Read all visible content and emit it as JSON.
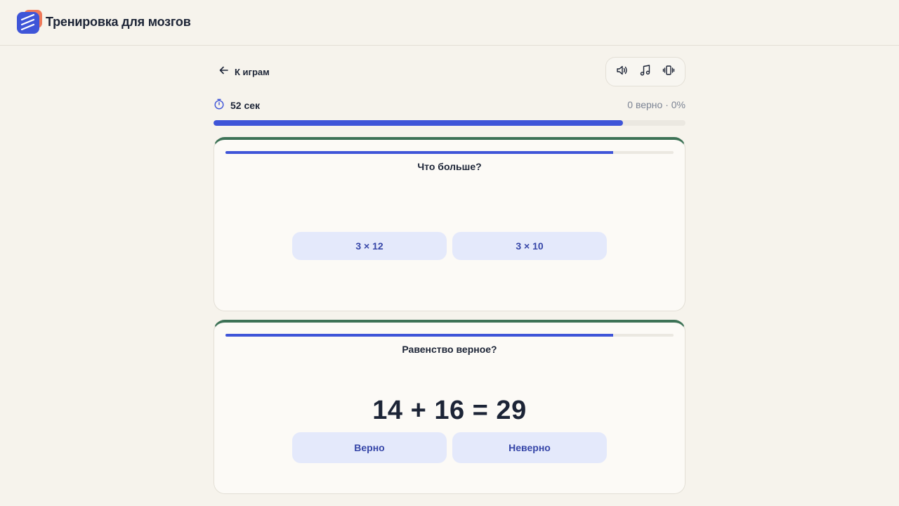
{
  "app": {
    "title": "Тренировка для мозгов"
  },
  "nav": {
    "back_label": "К играм"
  },
  "toolbar": {
    "icons": [
      "speaker-icon",
      "music-note-icon",
      "vibration-icon"
    ]
  },
  "status": {
    "timer": "52 сек",
    "score": "0 верно · 0%",
    "time_progress": 0.867
  },
  "cards": [
    {
      "question": "Что больше?",
      "progress": 0.865,
      "options": [
        "3 × 12",
        "3 × 10"
      ]
    },
    {
      "question": "Равенство верное?",
      "progress": 0.865,
      "equation": "14 + 16 = 29",
      "options": [
        "Верно",
        "Неверно"
      ]
    }
  ],
  "colors": {
    "background": "#f6f3ec",
    "accent": "#3f55d8",
    "card_top_border": "#3d7256",
    "answer_button_bg": "#e4e9fb",
    "answer_button_text": "#3646a8",
    "logo_back": "#ef7a5a"
  }
}
